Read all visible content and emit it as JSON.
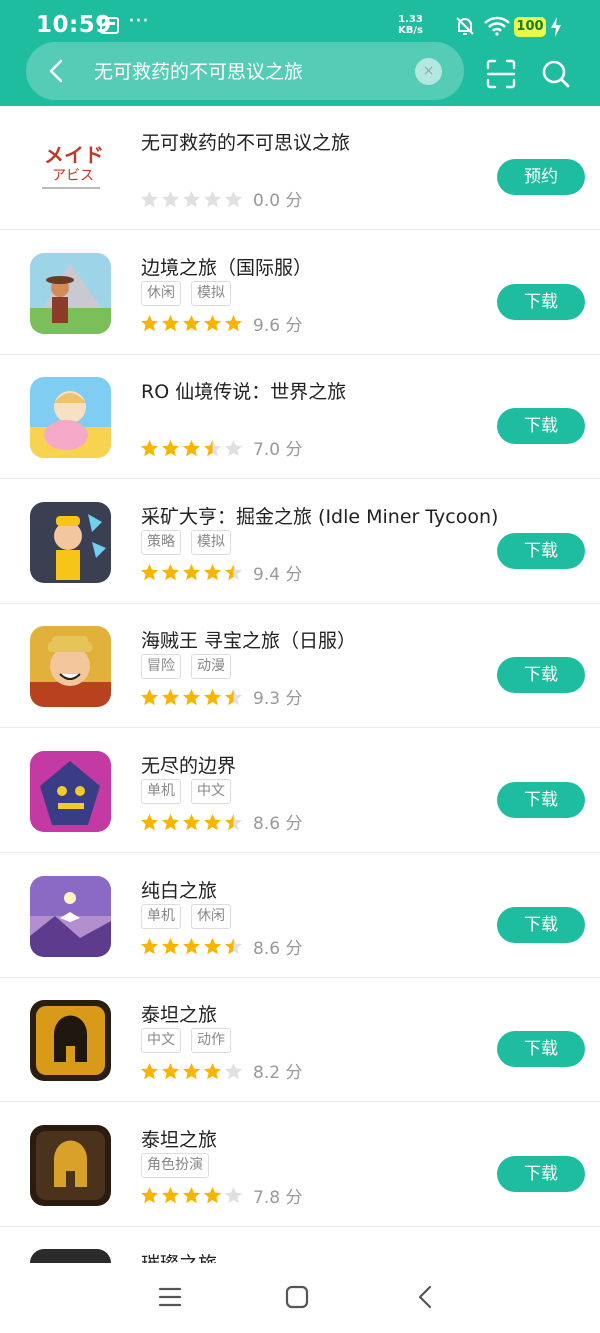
{
  "status_bar": {
    "time": "10:59",
    "network_speed_value": "1.33",
    "network_speed_unit": "KB/s",
    "battery": "100"
  },
  "search": {
    "query": "无可救药的不可思议之旅",
    "clear_label": "×"
  },
  "results": [
    {
      "title": "无可救药的不可思议之旅",
      "tags": [],
      "rating": 0.0,
      "score": "0.0 分",
      "action": "预约"
    },
    {
      "title": "边境之旅（国际服）",
      "tags": [
        "休闲",
        "模拟"
      ],
      "rating": 5.0,
      "score": "9.6 分",
      "action": "下载"
    },
    {
      "title": "RO 仙境传说：世界之旅",
      "tags": [],
      "rating": 3.5,
      "score": "7.0 分",
      "action": "下载"
    },
    {
      "title": "采矿大亨：掘金之旅 (Idle Miner Tycoon)",
      "tags": [
        "策略",
        "模拟"
      ],
      "rating": 4.5,
      "score": "9.4 分",
      "action": "下载"
    },
    {
      "title": "海贼王 寻宝之旅（日服）",
      "tags": [
        "冒险",
        "动漫"
      ],
      "rating": 4.5,
      "score": "9.3 分",
      "action": "下载"
    },
    {
      "title": "无尽的边界",
      "tags": [
        "单机",
        "中文"
      ],
      "rating": 4.5,
      "score": "8.6 分",
      "action": "下载"
    },
    {
      "title": "纯白之旅",
      "tags": [
        "单机",
        "休闲"
      ],
      "rating": 4.5,
      "score": "8.6 分",
      "action": "下载"
    },
    {
      "title": "泰坦之旅",
      "tags": [
        "中文",
        "动作"
      ],
      "rating": 4.0,
      "score": "8.2 分",
      "action": "下载"
    },
    {
      "title": "泰坦之旅",
      "tags": [
        "角色扮演"
      ],
      "rating": 4.0,
      "score": "7.8 分",
      "action": "下载"
    },
    {
      "title": "璀璨之旅",
      "tags": [],
      "rating": 0,
      "score": "",
      "action": ""
    }
  ],
  "colors": {
    "accent": "#1fbda0",
    "star_filled": "#f7b500",
    "star_empty": "#e0e0e0"
  }
}
